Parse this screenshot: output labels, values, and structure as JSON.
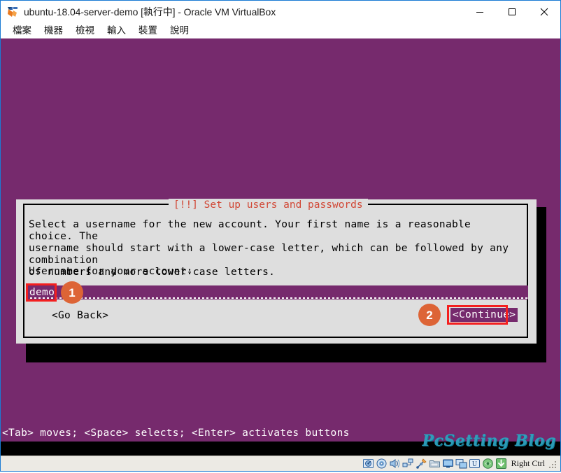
{
  "window": {
    "title": "ubuntu-18.04-server-demo [執行中] - Oracle VM VirtualBox",
    "icon": "virtualbox-icon",
    "controls": {
      "minimize": "minimize-icon",
      "maximize": "maximize-icon",
      "close": "close-icon"
    }
  },
  "menu": {
    "items": [
      {
        "label": "檔案"
      },
      {
        "label": "機器"
      },
      {
        "label": "檢視"
      },
      {
        "label": "輸入"
      },
      {
        "label": "裝置"
      },
      {
        "label": "說明"
      }
    ]
  },
  "vm": {
    "background_color": "#762A6D",
    "dialog": {
      "title_bracket_left": "[!!]",
      "title": "[!!] Set up users and passwords",
      "title_color": "#d14836",
      "body_text": "Select a username for the new account. Your first name is a reasonable choice. The\nusername should start with a lower-case letter, which can be followed by any combination\nof numbers and more lower-case letters.",
      "field_label": "Username for your account:",
      "input": {
        "value": "demo",
        "placeholder": ""
      },
      "buttons": {
        "go_back": "<Go Back>",
        "continue": "<Continue>"
      }
    },
    "annotations": [
      {
        "number": "1",
        "target": "username-input",
        "color": "#dd6436"
      },
      {
        "number": "2",
        "target": "continue-button",
        "color": "#dd6436"
      }
    ],
    "highlight_color": "#f41f1f",
    "hint_line": "<Tab> moves; <Space> selects; <Enter> activates buttons",
    "watermark": "PcSetting Blog"
  },
  "status_bar": {
    "icons": [
      "hard-disk-icon",
      "optical-disk-icon",
      "audio-icon",
      "network-icon",
      "usb-icon",
      "shared-folder-icon",
      "display-icon",
      "remote-desktop-icon",
      "video-capture-icon",
      "mouse-integration-icon",
      "keyboard-capture-icon"
    ],
    "host_key_label": "Right Ctrl",
    "resize_grip": "resize-grip-icon"
  }
}
